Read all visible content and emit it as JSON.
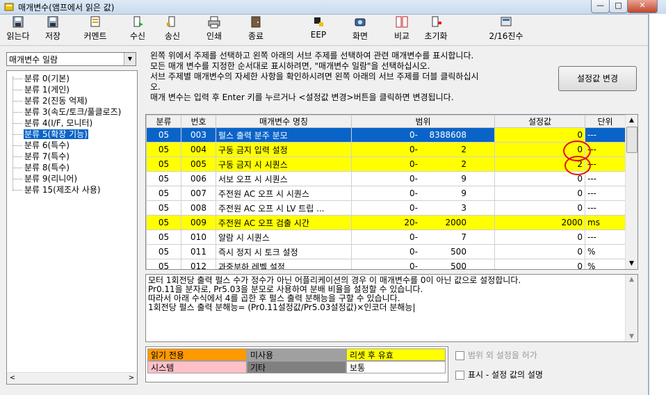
{
  "window": {
    "title": "매개변수(앰프에서 읽은 값)",
    "minimize": "—",
    "maximize": "□",
    "close": "✕"
  },
  "toolbar": [
    {
      "label": "읽는다",
      "icon": "read-icon"
    },
    {
      "label": "저장",
      "icon": "save-icon"
    },
    {
      "label": "커멘트",
      "icon": "comment-icon"
    },
    {
      "label": "수신",
      "icon": "receive-icon"
    },
    {
      "label": "송신",
      "icon": "send-icon"
    },
    {
      "label": "인쇄",
      "icon": "print-icon"
    },
    {
      "label": "종료",
      "icon": "exit-icon"
    },
    {
      "label": "EEP",
      "icon": "eep-icon"
    },
    {
      "label": "화면",
      "icon": "screen-icon"
    },
    {
      "label": "비교",
      "icon": "compare-icon"
    },
    {
      "label": "초기화",
      "icon": "initialize-icon"
    },
    {
      "label": "2/16진수",
      "icon": "hex-icon"
    }
  ],
  "category_select": {
    "value": "매개변수 일람"
  },
  "tree": [
    {
      "label": "분류 0(기본)",
      "selected": false
    },
    {
      "label": "분류 1(게인)",
      "selected": false
    },
    {
      "label": "분류 2(진동 억제)",
      "selected": false
    },
    {
      "label": "분류 3(속도/토크/풀클로즈)",
      "selected": false
    },
    {
      "label": "분류 4(I/F, 모니터)",
      "selected": false
    },
    {
      "label": "분류 5(확장 기능)",
      "selected": true
    },
    {
      "label": "분류 6(특수)",
      "selected": false
    },
    {
      "label": "분류 7(특수)",
      "selected": false
    },
    {
      "label": "분류 8(특수)",
      "selected": false
    },
    {
      "label": "분류 9(리니어)",
      "selected": false
    },
    {
      "label": "분류 15(제조사 사용)",
      "selected": false
    }
  ],
  "instructions": [
    "왼쪽 위에서 주제를 선택하고 왼쪽 아래의 서브 주제를 선택하여 관련 매개변수를 표시합니다.",
    "모든 매개 변수를 지정한 순서대로 표시하려면, \"매개변수 일람\"을 선택하십시오.",
    "서브 주제별 매개변수의 자세한 사항을 확인하시려면 왼쪽 아래의 서브 주제를 더블 클릭하십시",
    "오.",
    "매개 변수는 입력 후 Enter 키를 누르거나 <설정값 변경>버튼을 클릭하면 변경됩니다."
  ],
  "change_button": "설정값 변경",
  "table": {
    "headers": [
      "분류",
      "번호",
      "매개변수 명칭",
      "범위",
      "설정값",
      "단위"
    ],
    "rows": [
      {
        "cls": "05",
        "no": "003",
        "name": "펄스 출력 분주 분모",
        "min": "0-",
        "max": "8388608",
        "value": "0",
        "unit": "---",
        "style": "sel"
      },
      {
        "cls": "05",
        "no": "004",
        "name": "구동 금지 입력 설정",
        "min": "0-",
        "max": "2",
        "value": "0",
        "unit": "---",
        "style": "yel"
      },
      {
        "cls": "05",
        "no": "005",
        "name": "구동 금지 시 시퀀스",
        "min": "0-",
        "max": "2",
        "value": "2",
        "unit": "---",
        "style": "yel"
      },
      {
        "cls": "05",
        "no": "006",
        "name": "서보 오프 시 시퀀스",
        "min": "0-",
        "max": "9",
        "value": "0",
        "unit": "---",
        "style": ""
      },
      {
        "cls": "05",
        "no": "007",
        "name": "주전원 AC 오프 시 시퀀스",
        "min": "0-",
        "max": "9",
        "value": "0",
        "unit": "---",
        "style": ""
      },
      {
        "cls": "05",
        "no": "008",
        "name": "주전원 AC 오프 시 LV 트립 ...",
        "min": "0-",
        "max": "3",
        "value": "0",
        "unit": "---",
        "style": ""
      },
      {
        "cls": "05",
        "no": "009",
        "name": "주전원 AC 오프 검출 시간",
        "min": "20-",
        "max": "2000",
        "value": "2000",
        "unit": "ms",
        "style": "yel"
      },
      {
        "cls": "05",
        "no": "010",
        "name": "알람 시 시퀀스",
        "min": "0-",
        "max": "7",
        "value": "0",
        "unit": "---",
        "style": ""
      },
      {
        "cls": "05",
        "no": "011",
        "name": "즉시 정지 시 토크 설정",
        "min": "0-",
        "max": "500",
        "value": "0",
        "unit": "%",
        "style": ""
      },
      {
        "cls": "05",
        "no": "012",
        "name": "과중부하 레벨 설정",
        "min": "0-",
        "max": "500",
        "value": "0",
        "unit": "%",
        "style": ""
      }
    ]
  },
  "description": [
    "모터 1회전당 출력 펄스 수가 정수가 아닌 어플리케이션의 경우 이 매개변수를 0이 아닌 값으로 설정합니다.",
    "Pr0.11을 분자로, Pr5.03을 분모로 사용하여 분배 비율을 설정할 수 있습니다.",
    "따라서 아래 수식에서 4를 곱한 후 펄스 출력 분해능을 구할 수 있습니다.",
    "1회전당 펄스 출력 분해능= (Pr0.11설정값/Pr5.03설정값)×인코더 분해능|"
  ],
  "legend": [
    {
      "label": "읽기 전용",
      "color": "#ff9900"
    },
    {
      "label": "미사용",
      "color": "#a0a0a0"
    },
    {
      "label": "리셋 후 유효",
      "color": "#ffff00"
    },
    {
      "label": "시스템",
      "color": "#ffc0c8"
    },
    {
      "label": "기타",
      "color": "#808080"
    },
    {
      "label": "보통",
      "color": "#ffffff"
    }
  ],
  "checkboxes": [
    {
      "label": "범위 외 설정을 허가",
      "checked": false,
      "disabled": true
    },
    {
      "label": "표시 - 설정 값의 설명",
      "checked": false,
      "disabled": false
    }
  ]
}
